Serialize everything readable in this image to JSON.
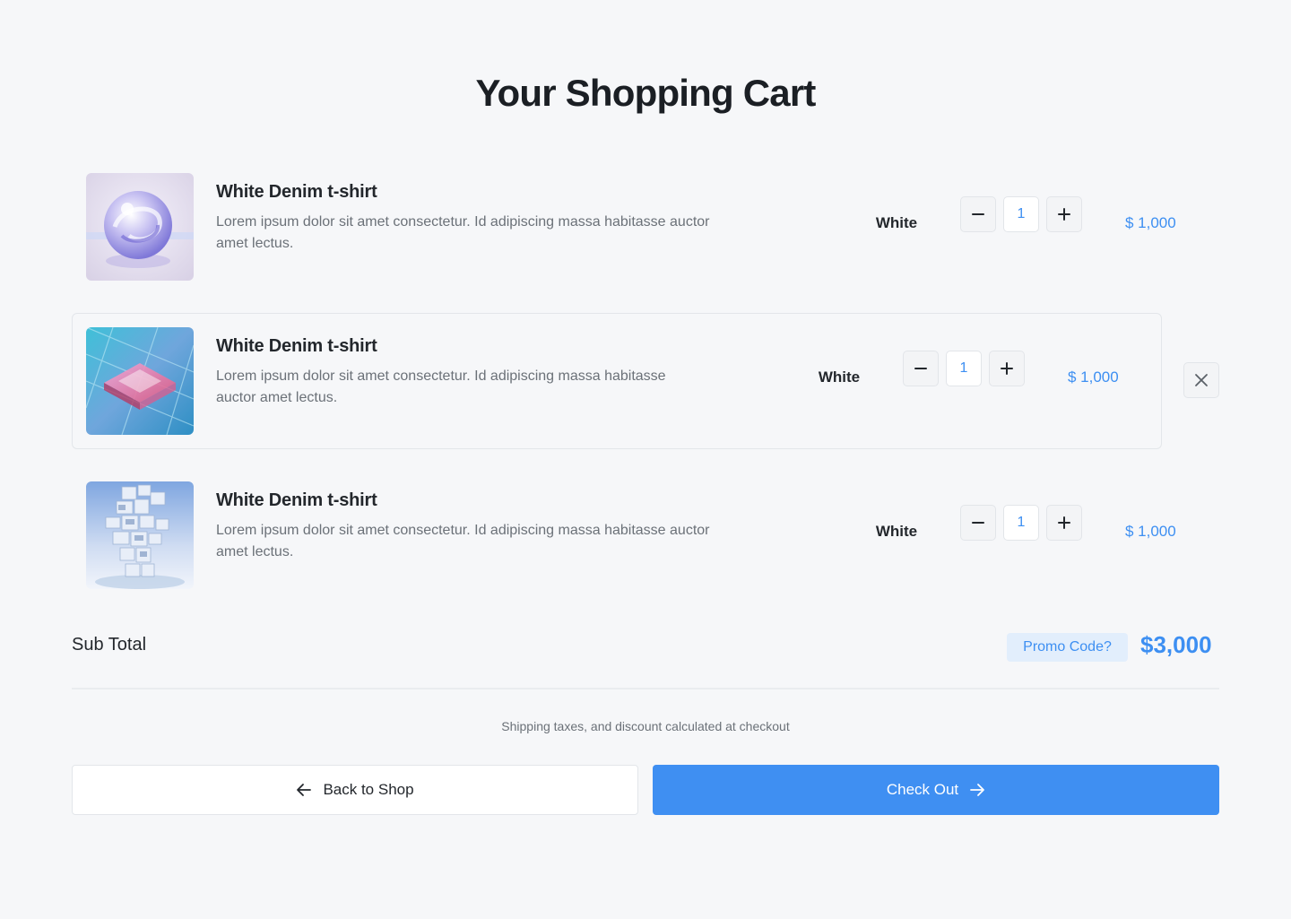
{
  "page": {
    "title": "Your Shopping Cart"
  },
  "cart": {
    "items": [
      {
        "title": "White Denim t-shirt",
        "description_lines": [
          "Lorem ipsum dolor sit amet consectetur. Id adipiscing massa habitasse auctor",
          "amet lectus."
        ],
        "variant": "White",
        "quantity": "1",
        "price": "$ 1,000",
        "image": "glass-sphere-image"
      },
      {
        "title": "White Denim t-shirt",
        "description_lines": [
          "Lorem ipsum dolor sit amet consectetur. Id adipiscing massa habitasse",
          "auctor amet lectus."
        ],
        "variant": "White",
        "quantity": "1",
        "price": "$ 1,000",
        "image": "glass-chip-image"
      },
      {
        "title": "White Denim t-shirt",
        "description_lines": [
          "Lorem ipsum dolor sit amet consectetur. Id adipiscing massa habitasse auctor",
          "amet lectus."
        ],
        "variant": "White",
        "quantity": "1",
        "price": "$ 1,000",
        "image": "glass-tower-image"
      }
    ],
    "controls": {
      "minus_icon": "minus-icon",
      "plus_icon": "plus-icon",
      "remove_icon": "close-icon"
    }
  },
  "summary": {
    "subtotal_label": "Sub Total",
    "promo_label": "Promo Code?",
    "subtotal_value": "$3,000",
    "shipping_note": "Shipping taxes, and discount calculated at checkout"
  },
  "actions": {
    "back_label": "Back to Shop",
    "back_icon": "arrow-left-icon",
    "checkout_label": "Check Out",
    "checkout_icon": "arrow-right-icon"
  },
  "colors": {
    "accent": "#3f8ff2",
    "background": "#f6f7f9",
    "promo_background": "#e2eefc"
  }
}
